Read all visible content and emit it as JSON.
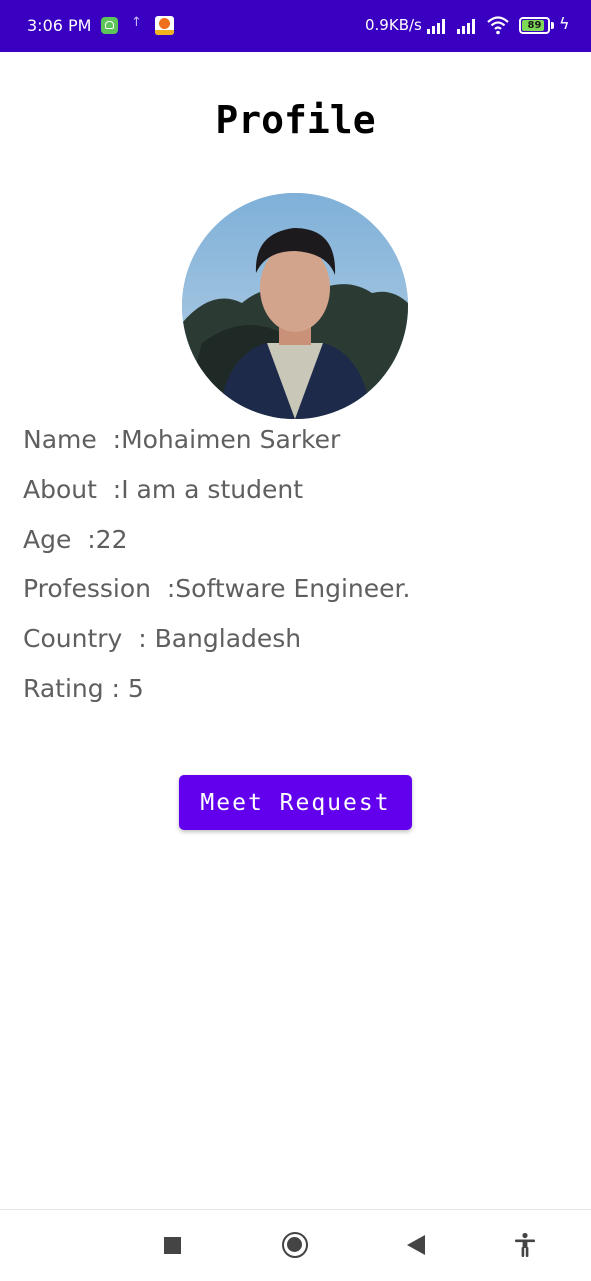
{
  "status_bar": {
    "time": "3:06 PM",
    "upload_indicator": "↑",
    "net_speed": "0.9KB/s",
    "battery": "89",
    "battery_level": 0.89,
    "charge_glyph": "ϟ",
    "icons": [
      "android-notification-icon",
      "upload-icon",
      "app-notification-icon",
      "signal-icon",
      "signal-icon",
      "wifi-icon",
      "battery-icon",
      "charging-icon"
    ],
    "color": "#3a00c2"
  },
  "profile": {
    "title": "Profile",
    "avatar_icon": "profile-photo",
    "fields": [
      {
        "text": "Name  :Mohaimen Sarker"
      },
      {
        "text": "About  :I am a student"
      },
      {
        "text": "Age  :22"
      },
      {
        "text": "Profession  :Software Engineer."
      },
      {
        "text": "Country  : Bangladesh"
      },
      {
        "text": "Rating : 5"
      }
    ]
  },
  "actions": {
    "meet_request_label": "Meet Request",
    "button_color": "#6200ee"
  },
  "nav_bar": {
    "icons": [
      "recents-icon",
      "home-icon",
      "back-icon",
      "accessibility-icon"
    ]
  }
}
